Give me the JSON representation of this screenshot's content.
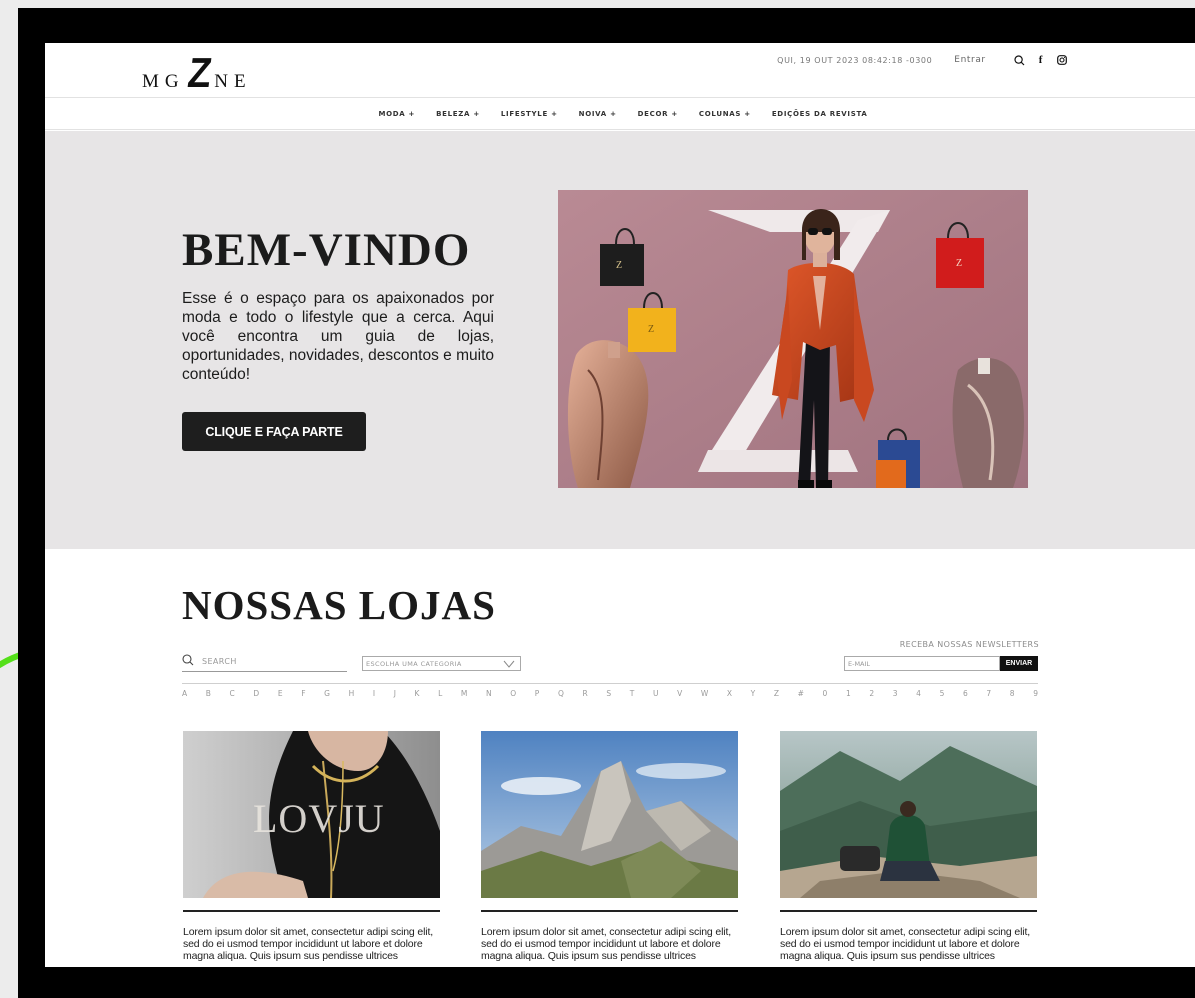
{
  "header": {
    "logo": {
      "left": "MG",
      "mark": "Z",
      "right": "NE"
    },
    "datetime": "QUI, 19 OUT 2023 08:42:18 -0300",
    "login_label": "Entrar",
    "icons": [
      "search-icon",
      "facebook-icon",
      "instagram-icon"
    ]
  },
  "nav": {
    "items": [
      "MODA +",
      "BELEZA +",
      "LIFESTYLE +",
      "NOIVA +",
      "DECOR +",
      "COLUNAS +",
      "EDIÇÕES DA REVISTA"
    ]
  },
  "hero": {
    "title": "BEM-VINDO",
    "text": "Esse é o espaço para os apaixonados por moda e todo o lifestyle que a cerca. Aqui você encontra um guia de lojas, oportunidades, novidades, descontos e muito conteúdo!",
    "button_label": "CLIQUE E FAÇA PARTE"
  },
  "stores": {
    "title": "NOSSAS LOJAS",
    "search_placeholder": "SEARCH",
    "category_placeholder": "ESCOLHA UMA CATEGORIA",
    "newsletter_label": "RECEBA NOSSAS NEWSLETTERS",
    "email_placeholder": "E-MAIL",
    "send_label": "ENVIAR",
    "alphabet": [
      "A",
      "B",
      "C",
      "D",
      "E",
      "F",
      "G",
      "H",
      "I",
      "J",
      "K",
      "L",
      "M",
      "N",
      "O",
      "P",
      "Q",
      "R",
      "S",
      "T",
      "U",
      "V",
      "W",
      "X",
      "Y",
      "Z",
      "#",
      "0",
      "1",
      "2",
      "3",
      "4",
      "5",
      "6",
      "7",
      "8",
      "9"
    ],
    "cards": [
      {
        "image_text": "LOVJU",
        "description": "Lorem ipsum dolor sit amet, consectetur adipi scing elit, sed do ei usmod tempor incididunt ut labore et dolore magna aliqua. Quis ipsum sus pendisse ultrices"
      },
      {
        "description": "Lorem ipsum dolor sit amet, consectetur adipi scing elit, sed do ei usmod tempor incididunt ut labore et dolore magna aliqua. Quis ipsum sus pendisse ultrices"
      },
      {
        "description": "Lorem ipsum dolor sit amet, consectetur adipi scing elit, sed do ei usmod tempor incididunt ut labore et dolore magna aliqua. Quis ipsum sus pendisse ultrices"
      }
    ]
  },
  "colors": {
    "accent_arc": "#55e01a",
    "hero_bg": "#e7e5e6",
    "button_bg": "#1e1e1e"
  }
}
